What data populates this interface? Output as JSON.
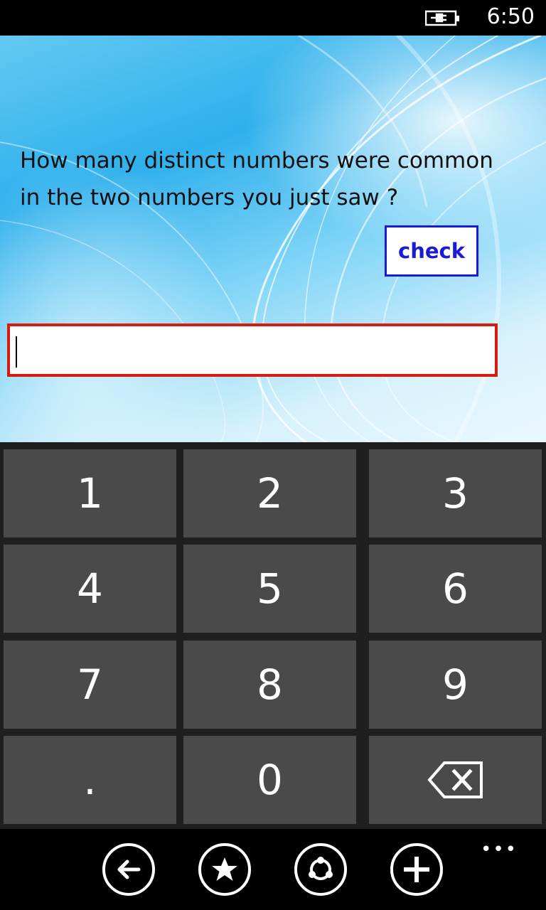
{
  "status_bar": {
    "time": "6:50",
    "battery_icon": "battery-charging-icon"
  },
  "question": {
    "text": "How many distinct numbers were common in the two numbers you just saw ?"
  },
  "check_button": {
    "label": "check",
    "color": "#1b1bd6"
  },
  "answer_field": {
    "value": "",
    "border_color": "#d81b10"
  },
  "keypad": {
    "keys": [
      {
        "label": "1"
      },
      {
        "label": "2"
      },
      {
        "label": "3"
      },
      {
        "label": "4"
      },
      {
        "label": "5"
      },
      {
        "label": "6"
      },
      {
        "label": "7"
      },
      {
        "label": "8"
      },
      {
        "label": "9"
      },
      {
        "label": "."
      },
      {
        "label": "0"
      },
      {
        "label": "",
        "icon": "backspace-icon"
      }
    ]
  },
  "app_bar": {
    "buttons": [
      {
        "icon": "back-arrow-icon"
      },
      {
        "icon": "star-icon"
      },
      {
        "icon": "share-icon"
      },
      {
        "icon": "add-icon"
      }
    ],
    "more_label": "•••"
  }
}
